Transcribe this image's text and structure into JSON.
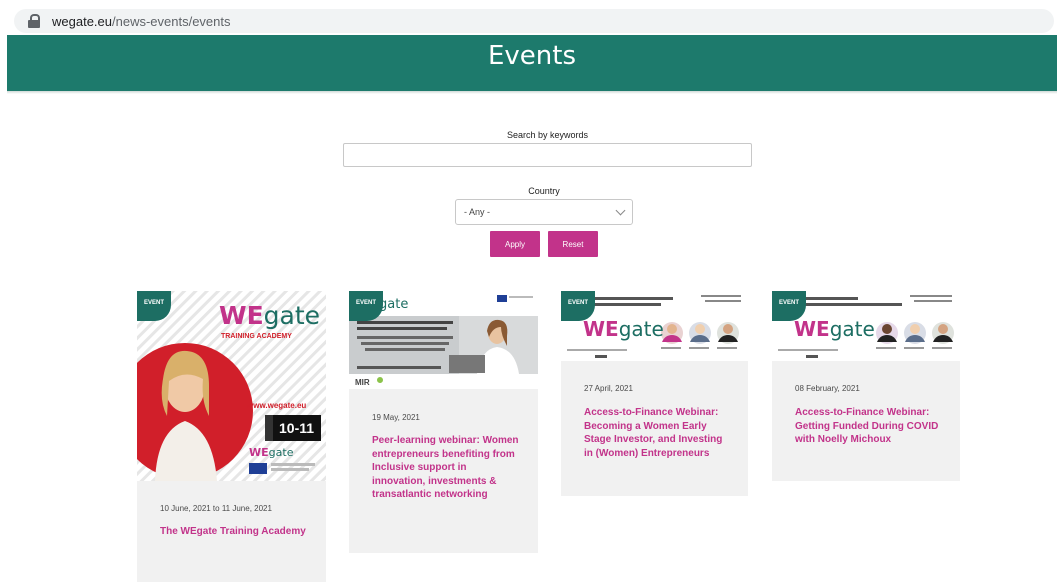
{
  "browser": {
    "url_host": "wegate.eu",
    "url_path": "/news-events/events"
  },
  "hero": {
    "title": "Events"
  },
  "filters": {
    "search_label": "Search by keywords",
    "search_value": "",
    "country_label": "Country",
    "country_selected": "- Any -",
    "apply_label": "Apply",
    "reset_label": "Reset"
  },
  "colors": {
    "accent": "#c2338a",
    "teal": "#1d7a6c",
    "card_bg": "#f1f1f1"
  },
  "events": [
    {
      "badge": "EVENT",
      "date": "10 June, 2021 to 11 June, 2021",
      "title": "The WEgate Training Academy",
      "thumb": {
        "logo_w": "WE",
        "logo_g": "gate",
        "subtitle": "TRAINING ACADEMY",
        "site": "www.wegate.eu",
        "days": "10-11",
        "small_logo_w": "WE",
        "small_logo_g": "gate"
      }
    },
    {
      "badge": "EVENT",
      "date": "19 May, 2021",
      "title": "Peer-learning webinar: Women entrepreneurs benefiting from Inclusive support in innovation, investments & transatlantic networking",
      "thumb": {
        "logo_g": "gate",
        "brand": "MIR"
      }
    },
    {
      "badge": "EVENT",
      "date": "27 April, 2021",
      "title": "Access-to-Finance Webinar: Becoming a Women Early Stage Investor, and Investing in (Women) Entrepreneurs",
      "thumb": {
        "logo_w": "WE",
        "logo_g": "gate"
      }
    },
    {
      "badge": "EVENT",
      "date": "08 February, 2021",
      "title": "Access-to-Finance Webinar: Getting Funded During COVID with Noelly Michoux",
      "thumb": {
        "logo_w": "WE",
        "logo_g": "gate"
      }
    }
  ]
}
